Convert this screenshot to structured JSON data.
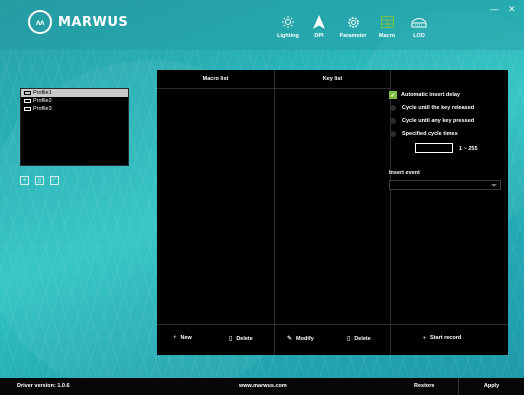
{
  "brand": {
    "logo_mark": "ʌʌ",
    "name": "MARWUS"
  },
  "nav": [
    {
      "label": "Lighting",
      "icon": "sun-icon"
    },
    {
      "label": "DPI",
      "icon": "pointer-icon"
    },
    {
      "label": "Parameter",
      "icon": "gear-icon"
    },
    {
      "label": "Macro",
      "icon": "macro-grid-icon"
    },
    {
      "label": "LOD",
      "icon": "lod-icon"
    }
  ],
  "window": {
    "minimize": "—",
    "close": "✕"
  },
  "profiles": {
    "items": [
      "Profile1",
      "Profile2",
      "Profile3"
    ],
    "selected_index": 0
  },
  "profile_buttons": {
    "add": "+",
    "delete": "▯",
    "edit": "⟋"
  },
  "macro": {
    "macro_list_header": "Macro list",
    "key_list_header": "Key list",
    "options": {
      "auto_insert_delay": "Automatic insert delay",
      "auto_insert_delay_checked": true,
      "cycle_until_released": "Cycle until the key released",
      "cycle_until_pressed": "Cycle until any key pressed",
      "specified_cycle_times": "Specified cycle times",
      "cycle_value": "",
      "range": "1 ~ 255"
    },
    "insert_event_label": "Insert event",
    "insert_event_value": "",
    "buttons": {
      "new": "New",
      "delete_macro": "Delete",
      "modify": "Modify",
      "delete_key": "Delete",
      "start_record": "Start record"
    }
  },
  "footer": {
    "driver_version": "Driver version: 1.0.6",
    "website": "www.marwus.com",
    "restore": "Restore",
    "apply": "Apply"
  },
  "colors": {
    "accent_green": "#7ac143",
    "teal": "#2aa9ad"
  }
}
